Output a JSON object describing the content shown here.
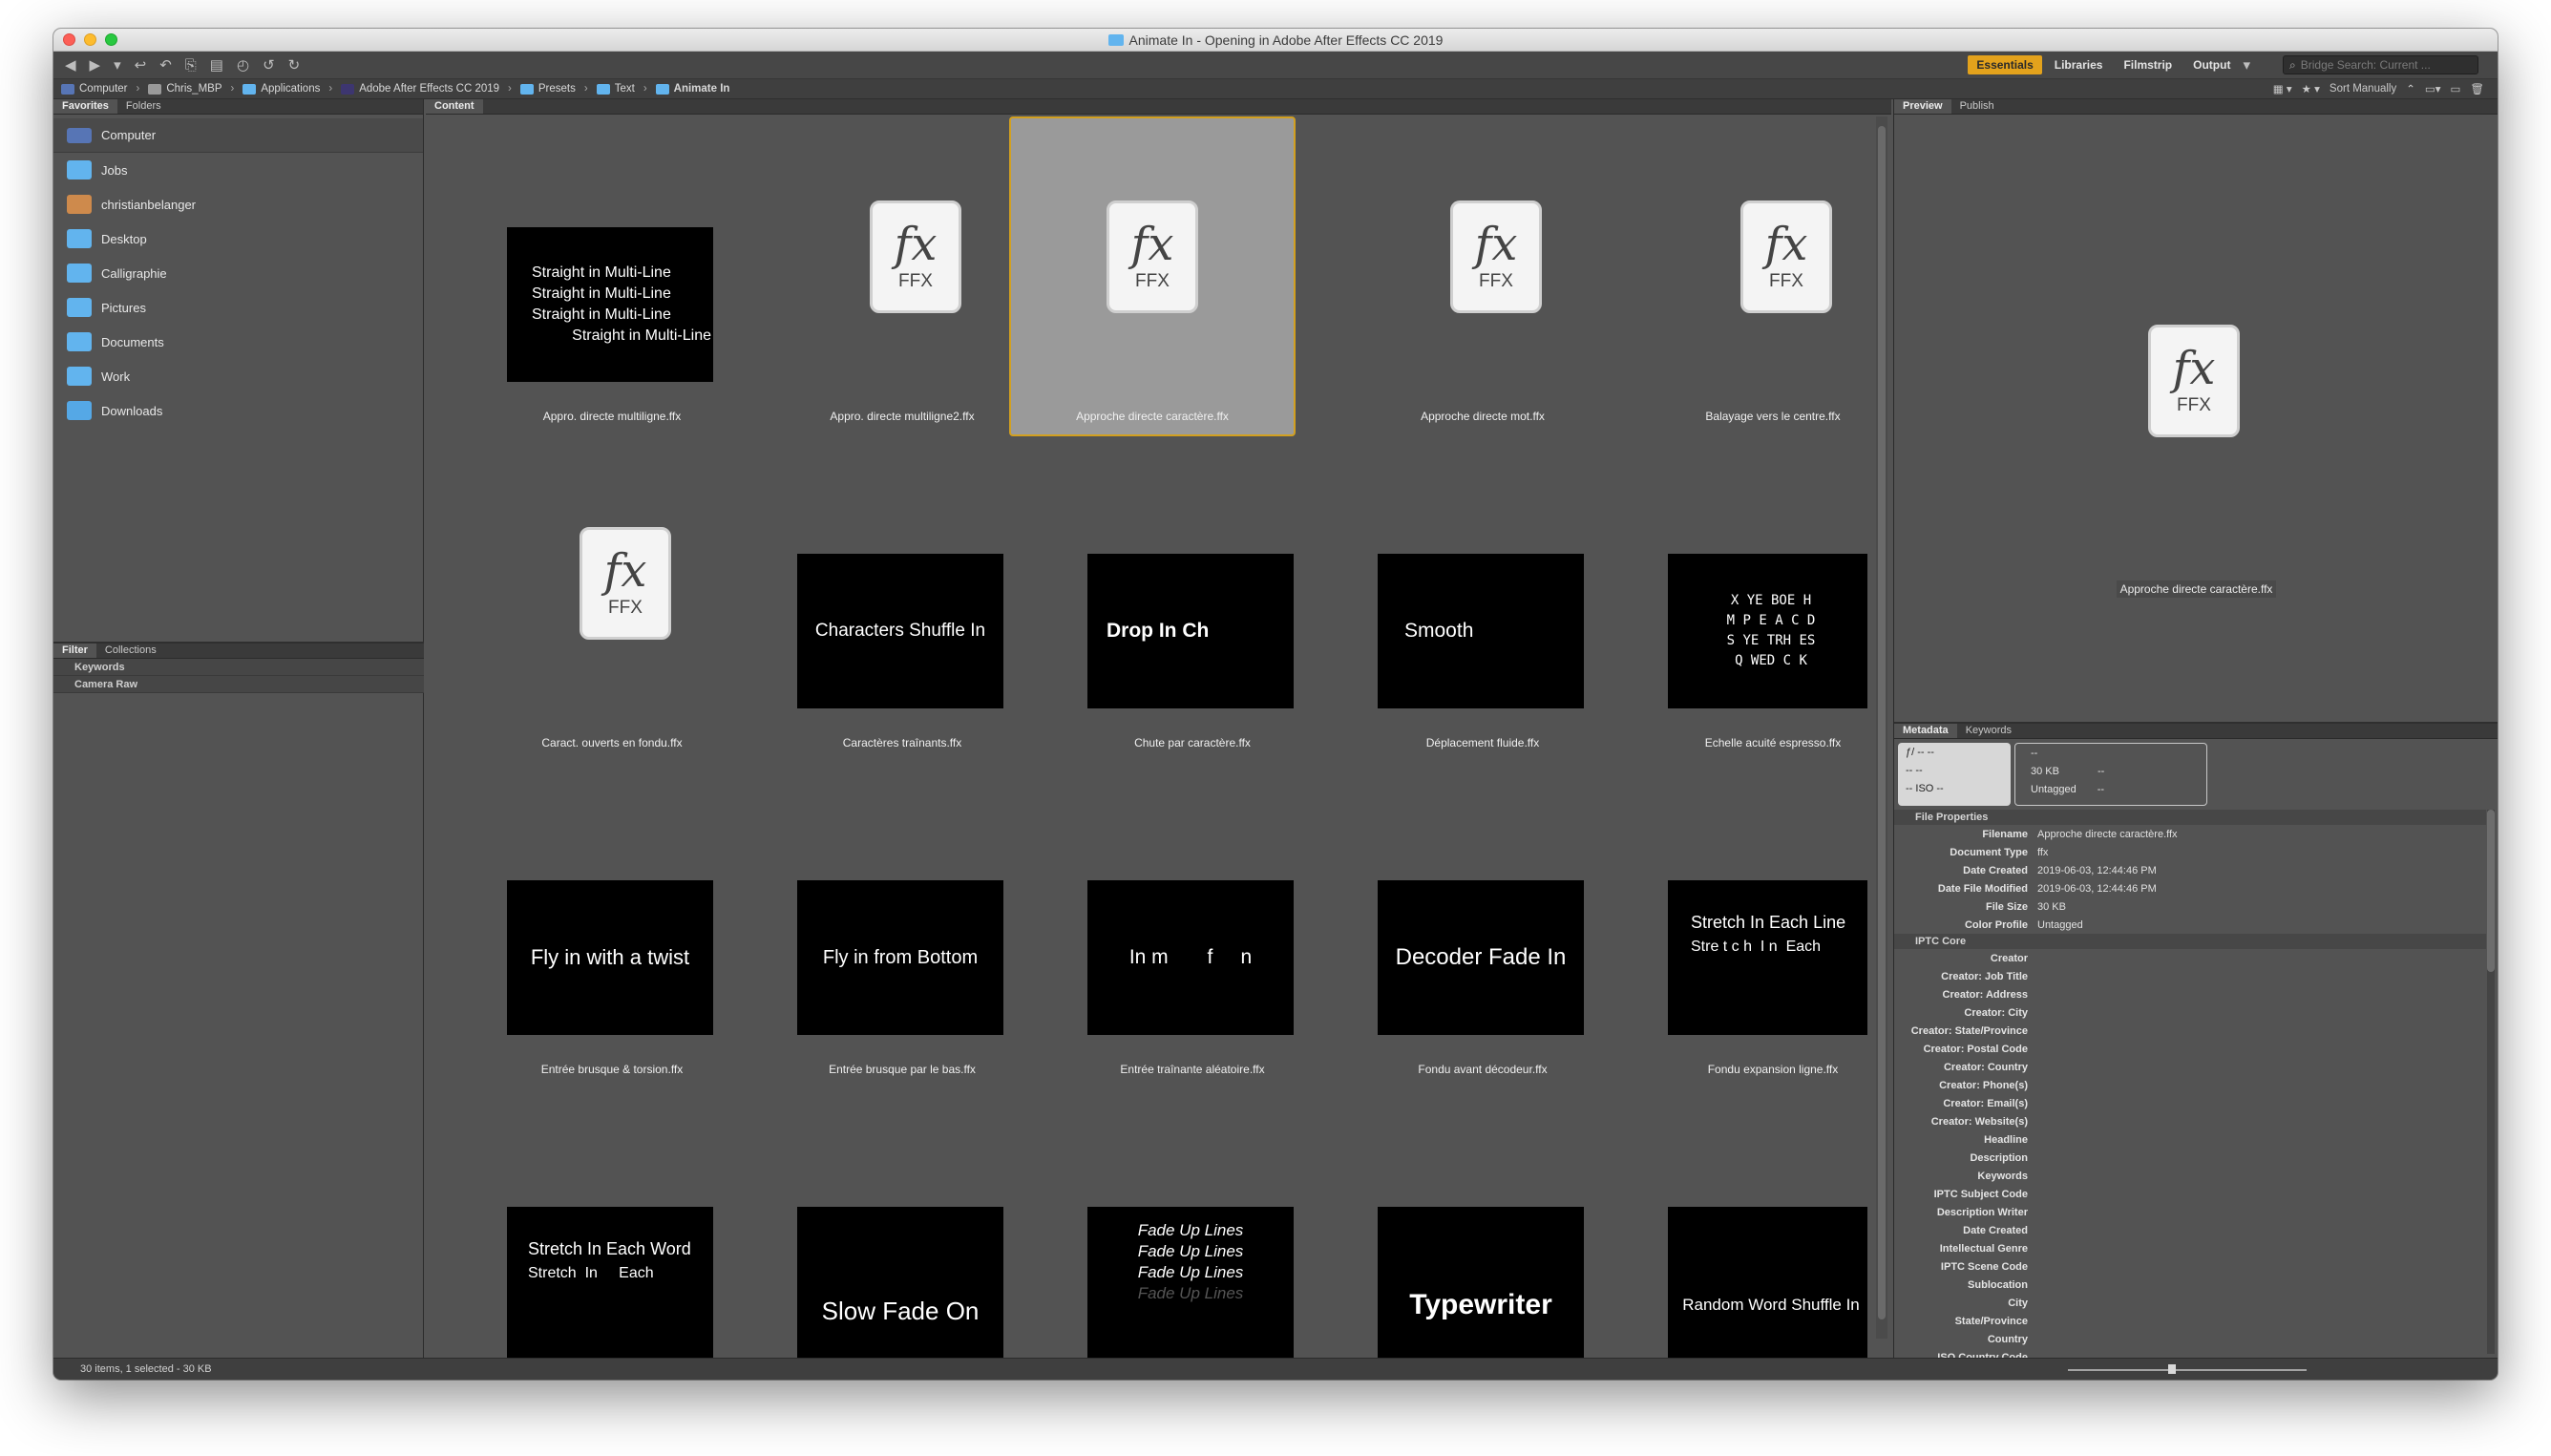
{
  "window": {
    "title": "Animate In - Opening in Adobe After Effects CC 2019"
  },
  "toolbar": {
    "workspaces": [
      "Essentials",
      "Libraries",
      "Filmstrip",
      "Output"
    ],
    "search_placeholder": "Bridge Search: Current ..."
  },
  "path": [
    "Computer",
    "Chris_MBP",
    "Applications",
    "Adobe After Effects CC 2019",
    "Presets",
    "Text",
    "Animate In"
  ],
  "pathbar": {
    "sort_label": "Sort Manually"
  },
  "left": {
    "tabs": [
      "Favorites",
      "Folders"
    ],
    "favorites": [
      "Computer",
      "Jobs",
      "christianbelanger",
      "Desktop",
      "Calligraphie",
      "Pictures",
      "Documents",
      "Work",
      "Downloads"
    ],
    "filter_tabs": [
      "Filter",
      "Collections"
    ],
    "filter_rows": [
      "Keywords",
      "Camera Raw"
    ]
  },
  "content": {
    "tab": "Content",
    "ffx_icon": {
      "fx": "fx",
      "ext": "FFX"
    },
    "items": [
      {
        "name": "Appro. directe multiligne.ffx",
        "thumb": [
          "Straight in Multi-Line",
          "Straight in Multi-Line",
          "Straight in Multi-Line",
          "Straight in Multi-Line"
        ]
      },
      {
        "name": "Appro. directe multiligne2.ffx"
      },
      {
        "name": "Approche directe caractère.ffx"
      },
      {
        "name": "Approche directe mot.ffx"
      },
      {
        "name": "Balayage vers le centre.ffx"
      },
      {
        "name": "Caract. ouverts en fondu.ffx"
      },
      {
        "name": "Caractères traînants.ffx",
        "thumb": [
          "Characters Shuffle In"
        ]
      },
      {
        "name": "Chute par caractère.ffx",
        "thumb": [
          "Drop In Ch"
        ]
      },
      {
        "name": "Déplacement fluide.ffx",
        "thumb": [
          "Smooth"
        ]
      },
      {
        "name": "Echelle acuité espresso.ffx",
        "thumb": [
          "X YE  BOE   H",
          "M P E  A  C D",
          "S YE  TRH  ES",
          "Q WED   C  K"
        ]
      },
      {
        "name": "Entrée brusque & torsion.ffx",
        "thumb": [
          "Fly in with a twist"
        ]
      },
      {
        "name": "Entrée brusque par le bas.ffx",
        "thumb": [
          "Fly in from Bottom"
        ]
      },
      {
        "name": "Entrée traînante aléatoire.ffx",
        "thumb": [
          "In m       f     n"
        ]
      },
      {
        "name": "Fondu avant décodeur.ffx",
        "thumb": [
          "Decoder Fade In"
        ]
      },
      {
        "name": "Fondu expansion ligne.ffx",
        "thumb": [
          "Stretch In Each Line",
          "Stre t c h  I n  Each"
        ]
      },
      {
        "name": "",
        "thumb": [
          "Stretch In Each Word",
          "Stretch  In     Each"
        ]
      },
      {
        "name": "",
        "thumb": [
          "Slow Fade On"
        ]
      },
      {
        "name": "",
        "thumb": [
          "Fade Up Lines",
          "Fade Up Lines",
          "Fade Up Lines",
          "Fade Up Lines"
        ]
      },
      {
        "name": "",
        "thumb": [
          "Typewriter"
        ]
      },
      {
        "name": "",
        "thumb": [
          "Random Word Shuffle In"
        ]
      }
    ]
  },
  "right": {
    "tabs": [
      "Preview",
      "Publish"
    ],
    "preview_name": "Approche directe caractère.ffx",
    "meta_tabs": [
      "Metadata",
      "Keywords"
    ],
    "camera": [
      "ƒ/ --    --",
      "--       --",
      "--      ISO --"
    ],
    "info": {
      "r1a": "--",
      "r2a": "30 KB",
      "r2b": "--",
      "r3a": "Untagged",
      "r3b": "--"
    },
    "file_props_title": "File Properties",
    "file_props": [
      [
        "Filename",
        "Approche directe caractère.ffx"
      ],
      [
        "Document Type",
        "ffx"
      ],
      [
        "Date Created",
        "2019-06-03, 12:44:46 PM"
      ],
      [
        "Date File Modified",
        "2019-06-03, 12:44:46 PM"
      ],
      [
        "File Size",
        "30 KB"
      ],
      [
        "Color Profile",
        "Untagged"
      ]
    ],
    "iptc_title": "IPTC Core",
    "iptc": [
      "Creator",
      "Creator: Job Title",
      "Creator: Address",
      "Creator: City",
      "Creator: State/Province",
      "Creator: Postal Code",
      "Creator: Country",
      "Creator: Phone(s)",
      "Creator: Email(s)",
      "Creator: Website(s)",
      "Headline",
      "Description",
      "Keywords",
      "IPTC Subject Code",
      "Description Writer",
      "Date Created",
      "Intellectual Genre",
      "IPTC Scene Code",
      "Sublocation",
      "City",
      "State/Province",
      "Country",
      "ISO Country Code"
    ]
  },
  "status": {
    "text": "30 items, 1 selected - 30 KB"
  }
}
